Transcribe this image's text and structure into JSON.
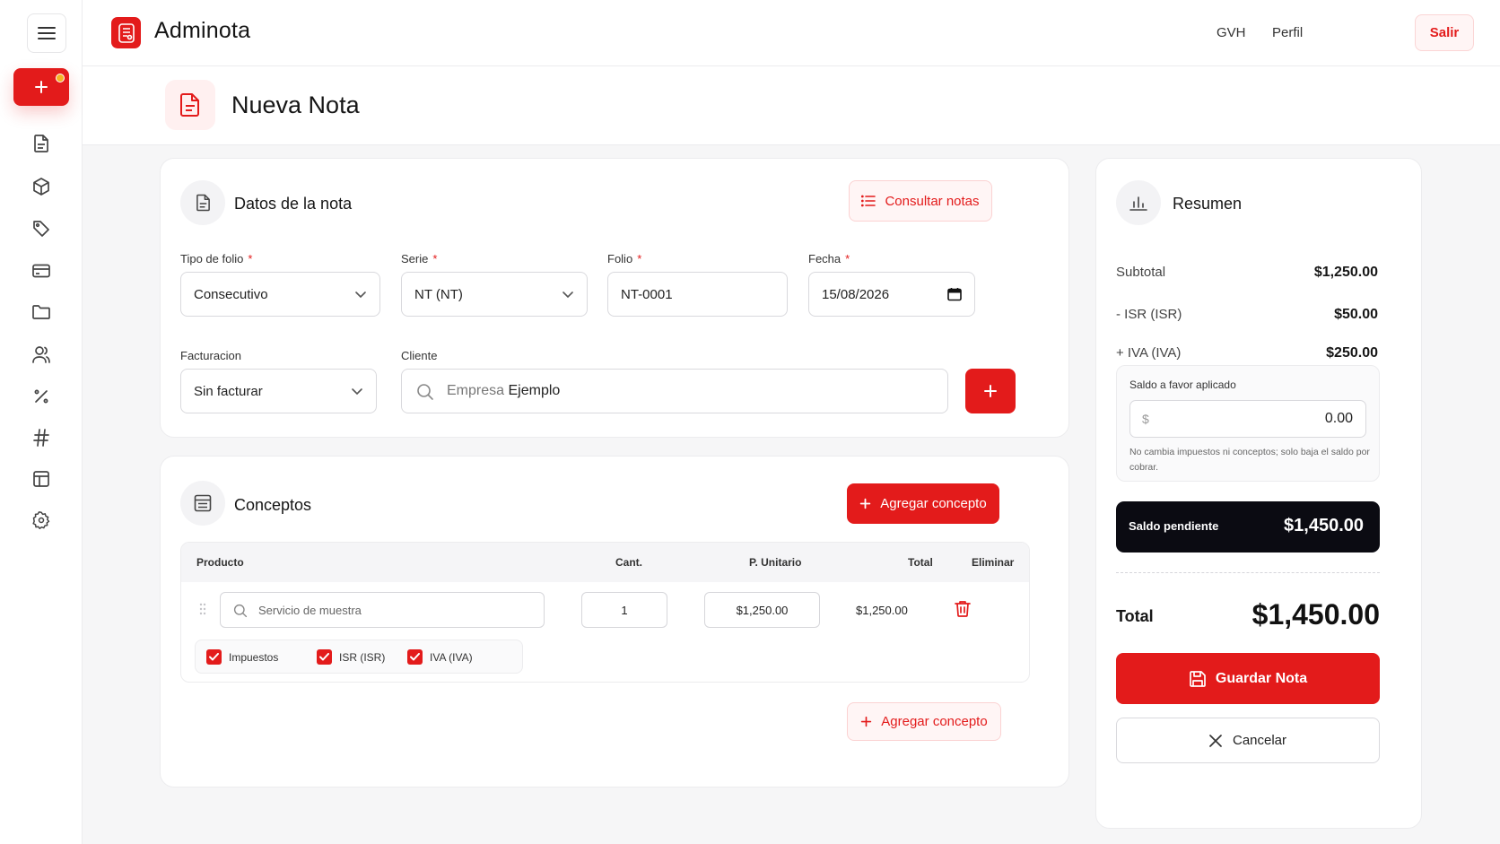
{
  "app": {
    "title": "Adminota"
  },
  "topbar": {
    "user": "GVH",
    "profile": "Perfil",
    "logout": "Salir"
  },
  "page": {
    "title": "Nueva Nota"
  },
  "sidebar": {
    "items": [
      {
        "icon": "document-icon"
      },
      {
        "icon": "box-icon"
      },
      {
        "icon": "tag-icon"
      },
      {
        "icon": "credit-card-icon"
      },
      {
        "icon": "folder-icon"
      },
      {
        "icon": "users-icon"
      },
      {
        "icon": "percent-icon"
      },
      {
        "icon": "hash-icon"
      },
      {
        "icon": "layout-icon"
      },
      {
        "icon": "gear-icon"
      }
    ]
  },
  "datos": {
    "title": "Datos de la nota",
    "consultar": "Consultar notas",
    "tipo_folio": {
      "label": "Tipo de folio",
      "value": "Consecutivo"
    },
    "serie": {
      "label": "Serie",
      "value": "NT (NT)"
    },
    "folio": {
      "label": "Folio",
      "value": "NT-0001"
    },
    "fecha": {
      "label": "Fecha",
      "value": "15/08/2026"
    },
    "facturacion": {
      "label": "Facturacion",
      "value": "Sin facturar"
    },
    "cliente": {
      "label": "Cliente",
      "placeholder_part": "Empresa",
      "value_part": "Ejemplo"
    },
    "required_mark": "*"
  },
  "conceptos": {
    "title": "Conceptos",
    "add_label": "Agregar concepto",
    "columns": {
      "producto": "Producto",
      "cant": "Cant.",
      "unitario": "P. Unitario",
      "total": "Total",
      "eliminar": "Eliminar"
    },
    "rows": [
      {
        "producto_placeholder": "Servicio de muestra",
        "cant": "1",
        "unitario": "$1,250.00",
        "total": "$1,250.00",
        "taxes": [
          {
            "label": "Impuestos",
            "checked": true
          },
          {
            "label": "ISR (ISR)",
            "checked": true
          },
          {
            "label": "IVA (IVA)",
            "checked": true
          }
        ]
      }
    ]
  },
  "resumen": {
    "title": "Resumen",
    "subtotal_label": "Subtotal",
    "subtotal": "$1,250.00",
    "isr_label": "- ISR (ISR)",
    "isr": "$50.00",
    "iva_label": "+ IVA (IVA)",
    "iva": "$250.00",
    "saldo_favor_label": "Saldo a favor aplicado",
    "saldo_favor_currency": "$",
    "saldo_favor_value": "0.00",
    "saldo_favor_note": "No cambia impuestos ni conceptos; solo baja el saldo por cobrar.",
    "pendiente_label": "Saldo pendiente",
    "pendiente": "$1,450.00",
    "total_label": "Total",
    "total": "$1,450.00",
    "guardar": "Guardar Nota",
    "cancelar": "Cancelar"
  },
  "colors": {
    "accent": "#e31b1b",
    "dark": "#0b0b12",
    "dot": "#f5b324"
  }
}
